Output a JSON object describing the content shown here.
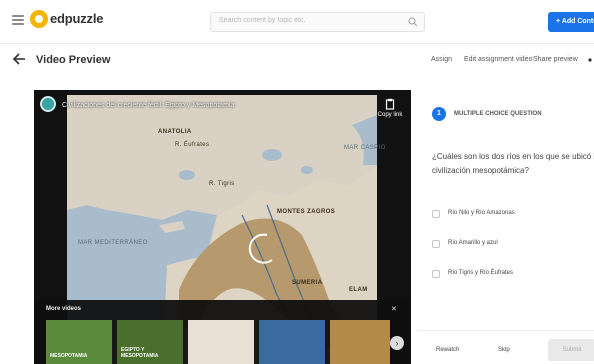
{
  "nav": {
    "logo": "edpuzzle",
    "search_placeholder": "Search content by topic etc.",
    "add_button": "+ Add Content"
  },
  "header": {
    "title": "Video Preview",
    "actions": [
      "Assign",
      "Edit assignment video",
      "Share preview"
    ]
  },
  "video": {
    "title": "Civilizaciones del creciente fértil: Egipto y Mesopotamia",
    "share_label": "Copy link",
    "map_labels": {
      "anatolia": "ANATOLIA",
      "r_eufrates": "R. Éufrates",
      "r_tigris": "R. Tigris",
      "montes_zagros": "MONTES ZAGROS",
      "mar_mediterraneo": "MAR MEDITERRÁNEO",
      "sumeria": "SUMERIA",
      "elam": "ELAM",
      "mar_caspio": "MAR CASPIO"
    },
    "more_videos_title": "More videos",
    "close_glyph": "✕",
    "next_glyph": "›",
    "thumbnails": [
      {
        "label": "MESOPOTAMIA",
        "color": "#5a8a3a"
      },
      {
        "label": "EGIPTO Y MESOPOTAMIA",
        "color": "#4b6f2d"
      },
      {
        "label": "",
        "color": "#e8e0d4"
      },
      {
        "label": "",
        "color": "#3a6aa0"
      },
      {
        "label": "",
        "color": "#b58a48"
      }
    ]
  },
  "question": {
    "number": "1",
    "type": "MULTIPLE CHOICE QUESTION",
    "text": "¿Cuáles son los dos ríos en los que se ubicó la civilización mesopotámica?",
    "options": [
      "Río Nilo y Río Amazonas",
      "Río Amarillo y azul",
      "Río Tigris y Río Éufrates"
    ],
    "rewatch": "Rewatch",
    "skip": "Skip",
    "submit": "Submit"
  }
}
